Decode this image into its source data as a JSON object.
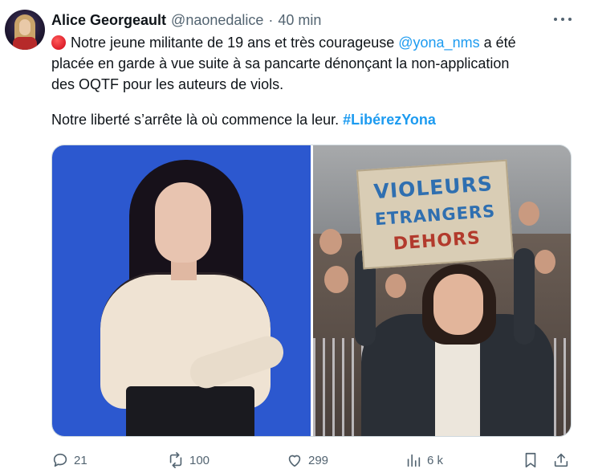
{
  "author": {
    "name": "Alice Georgeault",
    "handle": "@naonedalice",
    "separator": "·",
    "time": "40 min"
  },
  "tweet": {
    "line1_before": "Notre jeune militante de 19 ans et très courageuse ",
    "line1_mention": "@yona_nms",
    "line1_after": " a été",
    "line2": "placée en garde à vue suite à sa pancarte dénonçant la non-application",
    "line3": "des OQTF pour les auteurs de viols.",
    "line4_before": "Notre liberté s’arrête là où commence la leur. ",
    "line4_hashtag": "#LibérezYona",
    "emoji": "red-circle"
  },
  "sign": {
    "line1": "VIOLEURS",
    "line2": "ETRANGERS",
    "line3": "DEHORS"
  },
  "actions": {
    "replies": "21",
    "retweets": "100",
    "likes": "299",
    "views": "6 k"
  },
  "icons": {
    "more": "more-icon",
    "reply": "reply-icon",
    "retweet": "retweet-icon",
    "like": "heart-icon",
    "views": "views-icon",
    "bookmark": "bookmark-icon",
    "share": "share-icon"
  },
  "colors": {
    "link": "#1d9bf0",
    "muted": "#536471",
    "text": "#0f1419",
    "left_photo_bg": "#2c58cf"
  }
}
